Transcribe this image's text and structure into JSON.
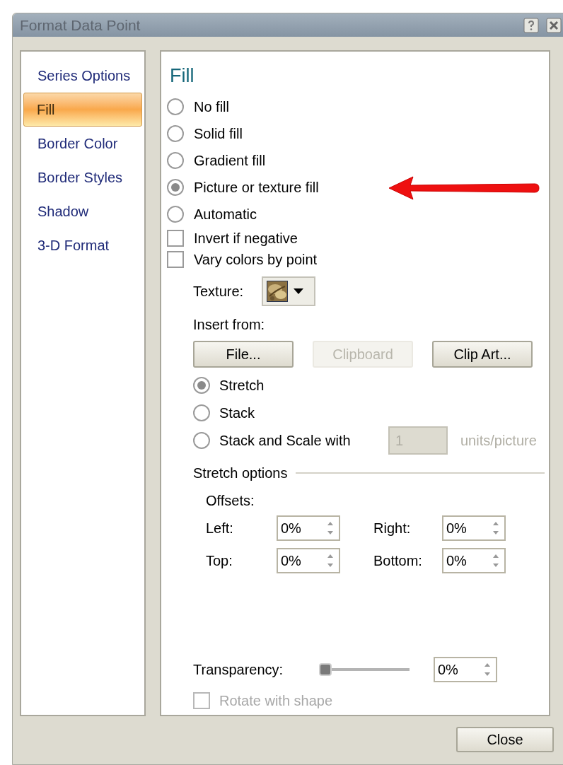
{
  "window": {
    "title": "Format Data Point"
  },
  "sidebar": {
    "items": [
      {
        "label": "Series Options",
        "selected": false
      },
      {
        "label": "Fill",
        "selected": true
      },
      {
        "label": "Border Color",
        "selected": false
      },
      {
        "label": "Border Styles",
        "selected": false
      },
      {
        "label": "Shadow",
        "selected": false
      },
      {
        "label": "3-D Format",
        "selected": false
      }
    ]
  },
  "panel": {
    "heading": "Fill",
    "fill_options": [
      {
        "label": "No fill",
        "selected": false
      },
      {
        "label": "Solid fill",
        "selected": false
      },
      {
        "label": "Gradient fill",
        "selected": false
      },
      {
        "label": "Picture or texture fill",
        "selected": true
      },
      {
        "label": "Automatic",
        "selected": false
      }
    ],
    "checkboxes": [
      {
        "label": "Invert if negative",
        "checked": false
      },
      {
        "label": "Vary colors by point",
        "checked": false
      }
    ],
    "texture": {
      "label": "Texture:"
    },
    "insert_from": {
      "label": "Insert from:",
      "buttons": [
        {
          "label": "File...",
          "disabled": false
        },
        {
          "label": "Clipboard",
          "disabled": true
        },
        {
          "label": "Clip Art...",
          "disabled": false
        }
      ]
    },
    "tiling": [
      {
        "label": "Stretch",
        "selected": true
      },
      {
        "label": "Stack",
        "selected": false
      },
      {
        "label": "Stack and Scale with",
        "selected": false
      }
    ],
    "scale_field": {
      "value": "1",
      "disabled": true,
      "unit": "units/picture"
    },
    "stretch_options": {
      "title": "Stretch options",
      "offsets_label": "Offsets:",
      "offsets": [
        {
          "label": "Left:",
          "value": "0%"
        },
        {
          "label": "Right:",
          "value": "0%"
        },
        {
          "label": "Top:",
          "value": "0%"
        },
        {
          "label": "Bottom:",
          "value": "0%"
        }
      ]
    },
    "transparency": {
      "label": "Transparency:",
      "level": 0,
      "value": "0%"
    },
    "rotate_with_shape": {
      "label": "Rotate with shape",
      "checked": false,
      "disabled": true
    }
  },
  "close_button": "Close"
}
